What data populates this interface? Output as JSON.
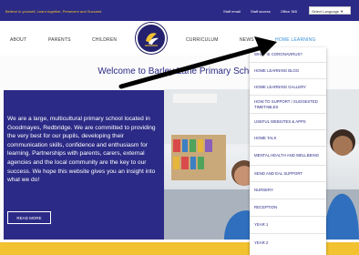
{
  "topbar": {
    "tagline": "Believe in yourself, Learn together, Persevere and Succeed",
    "links": [
      "Staff email",
      "Staff access",
      "Office 365"
    ],
    "language_label": "Select Language ▼"
  },
  "nav": {
    "items": [
      "ABOUT",
      "PARENTS",
      "CHILDREN",
      "CURRICULUM",
      "NEWS",
      "HOME LEARNING"
    ]
  },
  "hero": {
    "welcome": "Welcome to Barley Lane Primary School",
    "paragraph": "We are a large, multicultural primary school located in Goodmayes, Redbridge. We are committed to providing the very best for our pupils, developing their communication skills, confidence and enthusiasm for learning. Partnerships with parents, carers, external agencies and the local community are the key to our success. We hope this website gives you an insight into what we do!",
    "read_more": "READ MORE"
  },
  "dropdown": {
    "items": [
      "WHAT IS CORONAVIRUS?",
      "HOME LEARNING BLOG",
      "HOME LEARNING GALLERY",
      "HOW TO SUPPORT / SUGGESTED TIMETABLES",
      "USEFUL WEBSITES & APPS",
      "HOME TALK",
      "MENTAL HEALTH AND WELLBEING",
      "SEND AND EAL SUPPORT",
      "NURSERY",
      "RECEPTION",
      "YEAR 1",
      "YEAR 2"
    ]
  },
  "colors": {
    "brand_navy": "#2b2a86",
    "accent_yellow": "#f2c230",
    "active_link": "#3a8fd6"
  }
}
